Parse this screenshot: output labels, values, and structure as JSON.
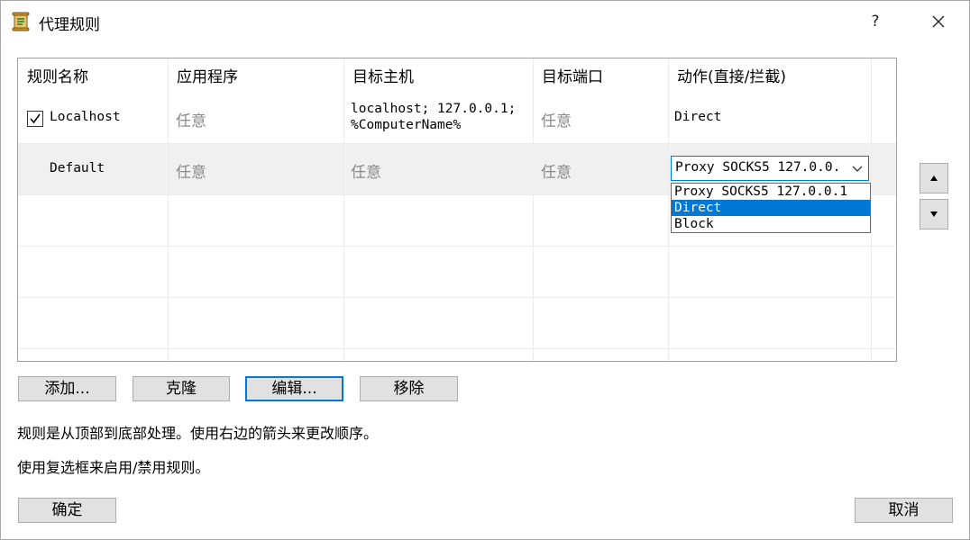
{
  "window": {
    "title": "代理规则",
    "help_label": "?"
  },
  "table": {
    "columns": [
      "规则名称",
      "应用程序",
      "目标主机",
      "目标端口",
      "动作(直接/拦截)"
    ],
    "rows": [
      {
        "checked": true,
        "name": "Localhost",
        "application": "任意",
        "host_line1": "localhost; 127.0.0.1;",
        "host_line2": "%ComputerName%",
        "port": "任意",
        "action": "Direct"
      },
      {
        "checked": false,
        "name": "Default",
        "application": "任意",
        "host": "任意",
        "port": "任意",
        "action": "Proxy SOCKS5 127.0.0."
      }
    ]
  },
  "action_dropdown": {
    "selected": "Proxy SOCKS5 127.0.0.",
    "options": [
      "Proxy SOCKS5 127.0.0.1",
      "Direct",
      "Block"
    ],
    "highlighted_index": 1
  },
  "buttons": {
    "add": "添加...",
    "clone": "克隆",
    "edit": "编辑...",
    "remove": "移除",
    "ok": "确定",
    "cancel": "取消"
  },
  "info": {
    "line1": "规则是从顶部到底部处理。使用右边的箭头来更改顺序。",
    "line2": "使用复选框来启用/禁用规则。"
  },
  "colors": {
    "accent": "#0078d7",
    "muted_text": "#8a8a8a",
    "button_face": "#e1e1e1"
  }
}
